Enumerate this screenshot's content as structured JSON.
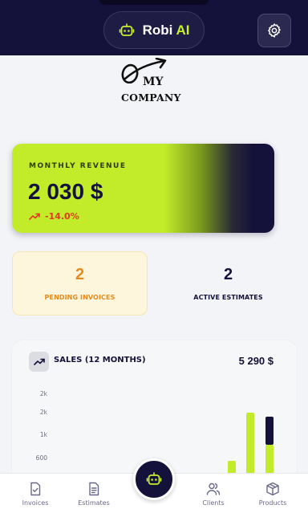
{
  "header": {
    "brand_prefix": "Robi",
    "brand_accent": "AI",
    "brand_icon": "robot-icon",
    "settings_icon": "gear-icon"
  },
  "logo": {
    "line1": "MY",
    "line2": "COMPANY"
  },
  "revenue": {
    "label": "MONTHLY REVENUE",
    "value": "2 030 $",
    "change": "-14.0%",
    "trend_icon": "trending-up-icon"
  },
  "stats": {
    "pending": {
      "value": "2",
      "label": "PENDING INVOICES"
    },
    "active": {
      "value": "2",
      "label": "ACTIVE ESTIMATES"
    }
  },
  "sales": {
    "title": "SALES (12 MONTHS)",
    "total": "5 290 $",
    "icon": "trending-up-icon"
  },
  "chart_data": {
    "type": "bar",
    "title": "SALES (12 MONTHS)",
    "y_ticks": [
      "2k",
      "2k",
      "1k",
      "600"
    ],
    "y_tick_values": [
      2000,
      1500,
      1000,
      600
    ],
    "series": [
      {
        "values": [
          600,
          1800,
          1000
        ]
      },
      {
        "values": [
          0,
          0,
          700
        ]
      }
    ],
    "colors": [
      "#c2ec2a",
      "#14113a"
    ]
  },
  "nav": {
    "items": [
      {
        "label": "Invoices",
        "icon": "invoice-icon"
      },
      {
        "label": "Estimates",
        "icon": "document-icon"
      },
      {
        "label": "Clients",
        "icon": "users-icon"
      },
      {
        "label": "Products",
        "icon": "box-icon"
      }
    ],
    "fab_icon": "robot-icon"
  },
  "colors": {
    "navy": "#14113a",
    "lime": "#c2ec2a",
    "orange": "#e58a1b",
    "negative": "#e33a1f"
  }
}
